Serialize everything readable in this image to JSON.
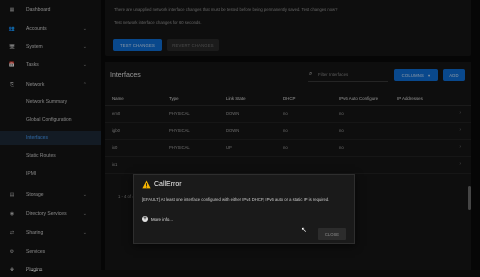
{
  "sidebar": {
    "items": [
      {
        "label": "Dashboard",
        "icon": "dashboard-icon",
        "glyph": "▦",
        "chevron": ""
      },
      {
        "label": "Accounts",
        "icon": "accounts-icon",
        "glyph": "👥",
        "chevron": "⌄"
      },
      {
        "label": "System",
        "icon": "system-icon",
        "glyph": "🖥",
        "chevron": "⌄"
      },
      {
        "label": "Tasks",
        "icon": "tasks-icon",
        "glyph": "📅",
        "chevron": "⌄"
      },
      {
        "label": "Network",
        "icon": "network-icon",
        "glyph": "⎘",
        "chevron": "⌃"
      },
      {
        "label": "Network Summary",
        "sub": true
      },
      {
        "label": "Global Configuration",
        "sub": true
      },
      {
        "label": "Interfaces",
        "sub": true,
        "active": true
      },
      {
        "label": "Static Routes",
        "sub": true
      },
      {
        "label": "IPMI",
        "sub": true
      },
      {
        "label": "Storage",
        "icon": "storage-icon",
        "glyph": "▤",
        "chevron": "⌄"
      },
      {
        "label": "Directory Services",
        "icon": "directory-services-icon",
        "glyph": "◉",
        "chevron": "⌄"
      },
      {
        "label": "Sharing",
        "icon": "sharing-icon",
        "glyph": "⇄",
        "chevron": "⌄"
      },
      {
        "label": "Services",
        "icon": "services-icon",
        "glyph": "⚙",
        "chevron": ""
      },
      {
        "label": "Plugins",
        "icon": "plugins-icon",
        "glyph": "✚",
        "chevron": ""
      }
    ]
  },
  "notice": {
    "line1": "There are unapplied network interface changes that must be tested before being permanently saved. Test changes now?",
    "line2": "Test network interface changes for     60     seconds.",
    "test_label": "TEST CHANGES",
    "revert_label": "REVERT CHANGES"
  },
  "interfaces": {
    "title": "Interfaces",
    "search_placeholder": "Filter Interfaces",
    "columns_label": "COLUMNS",
    "add_label": "ADD",
    "headers": [
      "Name",
      "Type",
      "Link State",
      "DHCP",
      "IPv6 Auto Configure",
      "IP Addresses"
    ],
    "rows": [
      [
        "em0",
        "PHYSICAL",
        "DOWN",
        "no",
        "no",
        ""
      ],
      [
        "igb0",
        "PHYSICAL",
        "DOWN",
        "no",
        "no",
        ""
      ],
      [
        "ix0",
        "PHYSICAL",
        "UP",
        "no",
        "no",
        ""
      ],
      [
        "ix1",
        "",
        "",
        "",
        "",
        ""
      ]
    ],
    "pager": "1 - 4 of 4"
  },
  "dialog": {
    "title": "CallError",
    "message": "[EFAULT] At least one interface configured with either IPv4 DHCP, IPv6 auto or a static IP is required.",
    "more_label": "More info...",
    "close_label": "CLOSE"
  },
  "colors": {
    "accent": "#0f6fd8",
    "active_nav": "#4aa3ff",
    "warning": "#f5b400"
  }
}
